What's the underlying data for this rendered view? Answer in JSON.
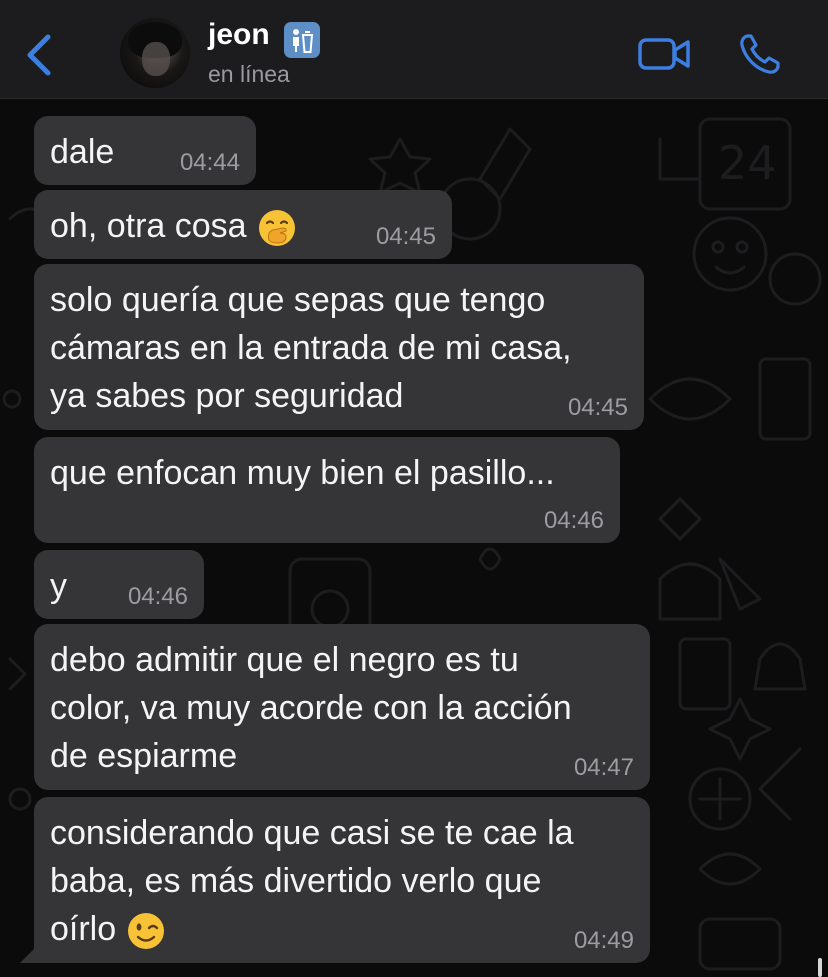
{
  "header": {
    "contact_name": "jeon",
    "status": "en línea",
    "badge_icon": "trash-icon",
    "accent_color": "#3d7fe0",
    "icons": [
      "back-chevron-icon",
      "video-camera-icon",
      "phone-icon"
    ]
  },
  "messages": [
    {
      "text": "dale",
      "time": "04:44"
    },
    {
      "text": "oh, otra cosa",
      "time": "04:45",
      "emoji": "face-with-hand-over-mouth"
    },
    {
      "text": "solo quería que sepas que tengo\ncámaras en la entrada de mi casa,\nya sabes por seguridad",
      "time": "04:45"
    },
    {
      "text": "que enfocan muy bien el pasillo...",
      "time": "04:46"
    },
    {
      "text": "y",
      "time": "04:46"
    },
    {
      "text": "debo admitir que el negro es tu\ncolor, va muy acorde con la acción\nde espiarme",
      "time": "04:47"
    },
    {
      "text": "considerando que casi se te cae la\nbaba, es más divertido verlo que\noírlo",
      "time": "04:49",
      "emoji": "winking-face"
    }
  ]
}
